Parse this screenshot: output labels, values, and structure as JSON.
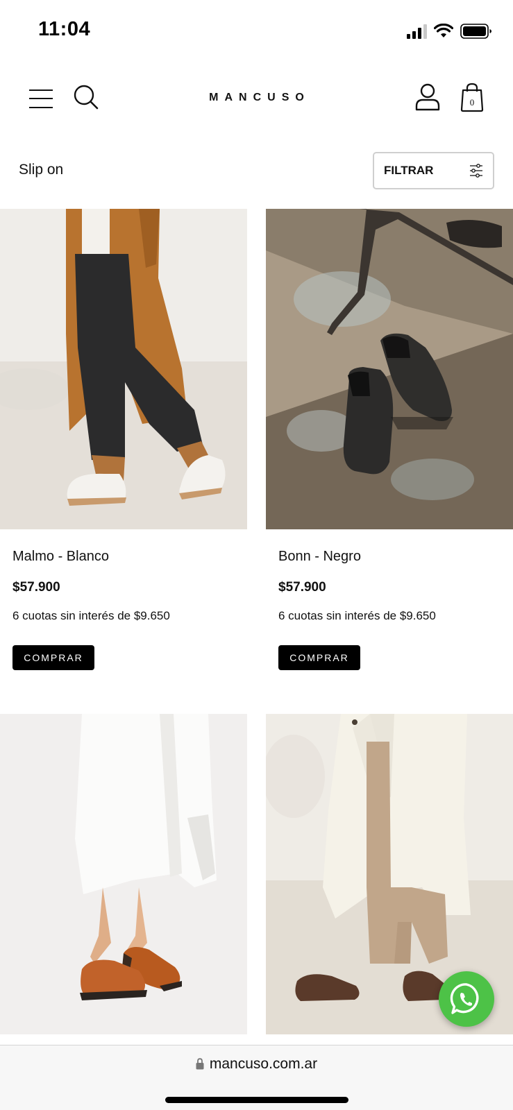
{
  "status_bar": {
    "time": "11:04",
    "icons": [
      "signal-icon",
      "wifi-icon",
      "battery-icon"
    ]
  },
  "header": {
    "logo": "MANCUSO",
    "cart_count": "0",
    "icons": [
      "hamburger-menu-icon",
      "search-icon",
      "user-icon",
      "shopping-bag-icon"
    ]
  },
  "toolbar": {
    "category": "Slip on",
    "filter_label": "FILTRAR"
  },
  "products": [
    {
      "name": "Malmo - Blanco",
      "price": "$57.900",
      "installments": "6 cuotas sin interés de $9.650",
      "button": "COMPRAR"
    },
    {
      "name": "Bonn - Negro",
      "price": "$57.900",
      "installments": "6 cuotas sin interés de $9.650",
      "button": "COMPRAR"
    },
    {
      "name": "",
      "price": "",
      "installments": "",
      "button": ""
    },
    {
      "name": "",
      "price": "",
      "installments": "",
      "button": ""
    }
  ],
  "browser": {
    "url": "mancuso.com.ar"
  },
  "colors": {
    "whatsapp": "#4dc247",
    "button": "#000000",
    "text": "#111111"
  }
}
